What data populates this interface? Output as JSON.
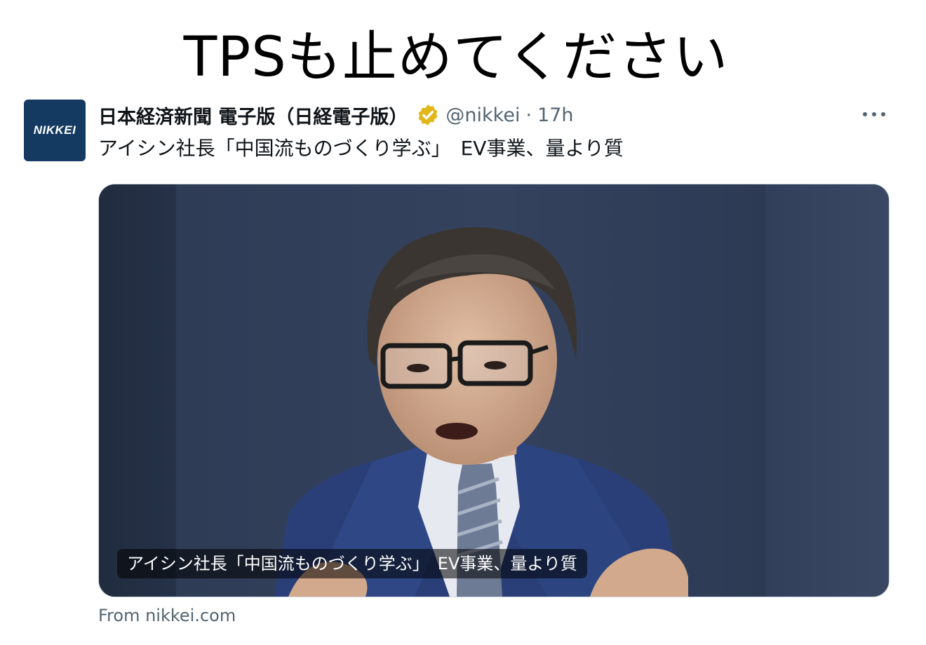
{
  "caption": "TPSも止めてください",
  "tweet": {
    "avatar_text": "NIKKEI",
    "display_name": "日本経済新聞 電子版（日経電子版）",
    "handle": "@nikkei",
    "separator": "·",
    "time": "17h",
    "text": "アイシン社長「中国流ものづくり学ぶ」　EV事業、量より質",
    "verified_color": "#e2b719",
    "brand_color": "#143a62"
  },
  "card": {
    "headline": "アイシン社長「中国流ものづくり学ぶ」　EV事業、量より質",
    "source": "From nikkei.com"
  }
}
